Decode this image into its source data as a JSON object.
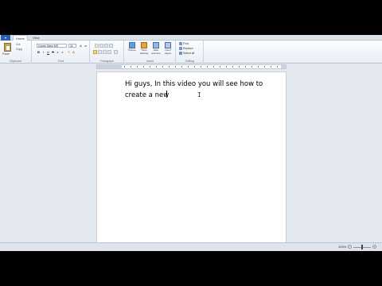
{
  "ribbon": {
    "tabs": [
      {
        "label": "Home",
        "active": true
      },
      {
        "label": "View",
        "active": false
      }
    ],
    "clipboard": {
      "paste_label": "Paste",
      "cut_label": "Cut",
      "copy_label": "Copy",
      "group_label": "Clipboard"
    },
    "font": {
      "family": "Comic Sans MS",
      "size": "11",
      "group_label": "Font"
    },
    "paragraph": {
      "group_label": "Paragraph"
    },
    "insert": {
      "items": [
        "Picture",
        "Paint drawing",
        "Date and time",
        "Insert object"
      ],
      "group_label": "Insert"
    },
    "editing": {
      "find": "Find",
      "replace": "Replace",
      "select_all": "Select all",
      "group_label": "Editing"
    }
  },
  "document": {
    "lines": [
      "Hi guys, In this video you will see how to",
      "create a new"
    ]
  },
  "status": {
    "zoom": "100%",
    "zoom_level": 0.5
  }
}
